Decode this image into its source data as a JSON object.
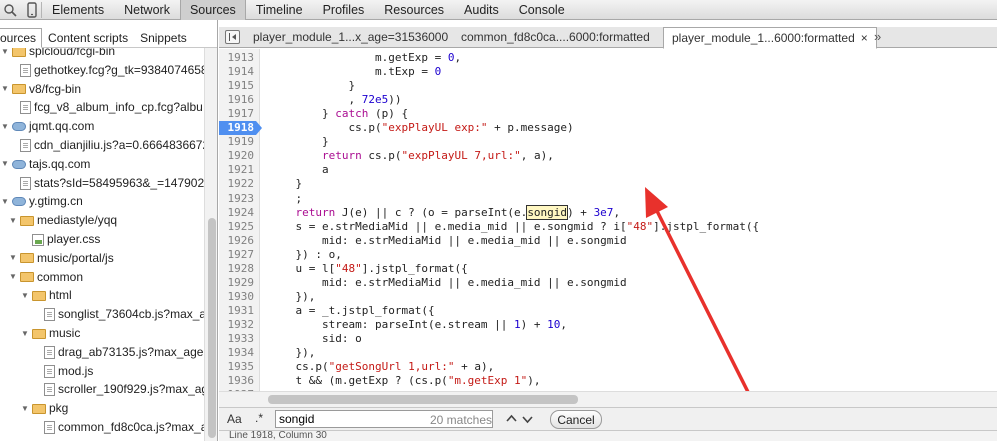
{
  "toolbar": {
    "tabs": [
      {
        "label": "Elements"
      },
      {
        "label": "Network"
      },
      {
        "label": "Sources"
      },
      {
        "label": "Timeline"
      },
      {
        "label": "Profiles"
      },
      {
        "label": "Resources"
      },
      {
        "label": "Audits"
      },
      {
        "label": "Console"
      }
    ],
    "active_tab": "Sources"
  },
  "navigator": {
    "tabs": [
      {
        "label": "ources"
      },
      {
        "label": "Content scripts"
      },
      {
        "label": "Snippets"
      }
    ],
    "tree": [
      {
        "label": "splcloud/fcgi-bin",
        "icon": "folder-icon",
        "expanded": true
      },
      {
        "label": "gethotkey.fcg?g_tk=9384074658",
        "icon": "file-icon"
      },
      {
        "label": "v8/fcg-bin",
        "icon": "folder-icon",
        "expanded": true
      },
      {
        "label": "fcg_v8_album_info_cp.fcg?albu",
        "icon": "file-icon"
      },
      {
        "label": "jqmt.qq.com",
        "icon": "cloud-icon",
        "expanded": true
      },
      {
        "label": "cdn_dianjiliu.js?a=0.666483667213",
        "icon": "file-icon"
      },
      {
        "label": "tajs.qq.com",
        "icon": "cloud-icon",
        "expanded": true
      },
      {
        "label": "stats?sId=58495963&_=147902869",
        "icon": "file-icon"
      },
      {
        "label": "y.gtimg.cn",
        "icon": "cloud-icon",
        "expanded": true
      },
      {
        "label": "mediastyle/yqq",
        "icon": "folder-icon",
        "expanded": true
      },
      {
        "label": "player.css",
        "icon": "image-file-icon"
      },
      {
        "label": "music/portal/js",
        "icon": "folder-icon",
        "expanded": true
      },
      {
        "label": "common",
        "icon": "folder-icon",
        "expanded": true
      },
      {
        "label": "html",
        "icon": "folder-icon",
        "expanded": true
      },
      {
        "label": "songlist_73604cb.js?max_age",
        "icon": "file-icon"
      },
      {
        "label": "music",
        "icon": "folder-icon",
        "expanded": true
      },
      {
        "label": "drag_ab73135.js?max_age=",
        "icon": "file-icon"
      },
      {
        "label": "mod.js",
        "icon": "file-icon"
      },
      {
        "label": "scroller_190f929.js?max_age",
        "icon": "file-icon"
      },
      {
        "label": "pkg",
        "icon": "folder-icon",
        "expanded": true
      },
      {
        "label": "common_fd8c0ca.js?max_a",
        "icon": "file-icon"
      }
    ]
  },
  "editor": {
    "tabs": [
      {
        "label": "player_module_1...x_age=31536000"
      },
      {
        "label": "common_fd8c0ca....6000:formatted"
      },
      {
        "label": "player_module_1...6000:formatted",
        "active": true
      }
    ],
    "more": "»",
    "close_glyph": "×",
    "breakpoint_line": "1918",
    "lines": [
      {
        "n": "1913",
        "parts": [
          {
            "t": "                m.getExp = "
          },
          {
            "t": "0",
            "c": "num"
          },
          {
            "t": ","
          }
        ]
      },
      {
        "n": "1914",
        "parts": [
          {
            "t": "                m.tExp = "
          },
          {
            "t": "0",
            "c": "num"
          }
        ]
      },
      {
        "n": "1915",
        "parts": [
          {
            "t": "            }"
          }
        ]
      },
      {
        "n": "1916",
        "parts": [
          {
            "t": "            , "
          },
          {
            "t": "72e5",
            "c": "num"
          },
          {
            "t": "))"
          }
        ]
      },
      {
        "n": "1917",
        "parts": [
          {
            "t": "        } "
          },
          {
            "t": "catch",
            "c": "kw"
          },
          {
            "t": " (p) {"
          }
        ]
      },
      {
        "n": "1918",
        "parts": [
          {
            "t": "            cs.p("
          },
          {
            "t": "\"expPlayUL exp:\"",
            "c": "str"
          },
          {
            "t": " + p.message)"
          }
        ]
      },
      {
        "n": "1919",
        "parts": [
          {
            "t": "        }"
          }
        ]
      },
      {
        "n": "1920",
        "parts": [
          {
            "t": "        "
          },
          {
            "t": "return",
            "c": "kw"
          },
          {
            "t": " cs.p("
          },
          {
            "t": "\"expPlayUL 7,url:\"",
            "c": "str"
          },
          {
            "t": ", a),"
          }
        ]
      },
      {
        "n": "1921",
        "parts": [
          {
            "t": "        a"
          }
        ]
      },
      {
        "n": "1922",
        "parts": [
          {
            "t": "    }"
          }
        ]
      },
      {
        "n": "1923",
        "parts": [
          {
            "t": "    ;"
          }
        ]
      },
      {
        "n": "1924",
        "parts": [
          {
            "t": "    "
          },
          {
            "t": "return",
            "c": "kw"
          },
          {
            "t": " J(e) || c ? (o = parseInt(e."
          },
          {
            "t": "songid",
            "c": "hl"
          },
          {
            "t": ") + "
          },
          {
            "t": "3e7",
            "c": "num"
          },
          {
            "t": ","
          }
        ]
      },
      {
        "n": "1925",
        "parts": [
          {
            "t": "    s = e.strMediaMid || e.media_mid || e.songmid ? i["
          },
          {
            "t": "\"48\"",
            "c": "str"
          },
          {
            "t": "].jstpl_format({"
          }
        ]
      },
      {
        "n": "1926",
        "parts": [
          {
            "t": "        mid: e.strMediaMid || e.media_mid || e.songmid"
          }
        ]
      },
      {
        "n": "1927",
        "parts": [
          {
            "t": "    }) : o,"
          }
        ]
      },
      {
        "n": "1928",
        "parts": [
          {
            "t": "    u = l["
          },
          {
            "t": "\"48\"",
            "c": "str"
          },
          {
            "t": "].jstpl_format({"
          }
        ]
      },
      {
        "n": "1929",
        "parts": [
          {
            "t": "        mid: e.strMediaMid || e.media_mid || e.songmid"
          }
        ]
      },
      {
        "n": "1930",
        "parts": [
          {
            "t": "    }),"
          }
        ]
      },
      {
        "n": "1931",
        "parts": [
          {
            "t": "    a = _t.jstpl_format({"
          }
        ]
      },
      {
        "n": "1932",
        "parts": [
          {
            "t": "        stream: parseInt(e.stream || "
          },
          {
            "t": "1",
            "c": "num"
          },
          {
            "t": ") + "
          },
          {
            "t": "10",
            "c": "num"
          },
          {
            "t": ","
          }
        ]
      },
      {
        "n": "1933",
        "parts": [
          {
            "t": "        sid: o"
          }
        ]
      },
      {
        "n": "1934",
        "parts": [
          {
            "t": "    }),"
          }
        ]
      },
      {
        "n": "1935",
        "parts": [
          {
            "t": "    cs.p("
          },
          {
            "t": "\"getSongUrl 1,url:\"",
            "c": "str"
          },
          {
            "t": " + a),"
          }
        ]
      },
      {
        "n": "1936",
        "parts": [
          {
            "t": "    t && (m.getExp ? (cs.p("
          },
          {
            "t": "\"m.getExp 1\"",
            "c": "str"
          },
          {
            "t": "),"
          }
        ]
      },
      {
        "n": "1937",
        "parts": [
          {
            "t": ""
          }
        ]
      }
    ]
  },
  "search": {
    "case_toggle": "Aa",
    "regex_toggle": ".*",
    "query": "songid",
    "match_count": "20 matches",
    "cancel_label": "Cancel"
  },
  "status": {
    "text": "Line 1918, Column 30"
  },
  "colors": {
    "breakpoint": "#4f8ff0",
    "annotation_arrow": "#e8312c",
    "keyword": "#aa0d91",
    "string": "#c41a16",
    "number": "#1c00cf"
  }
}
